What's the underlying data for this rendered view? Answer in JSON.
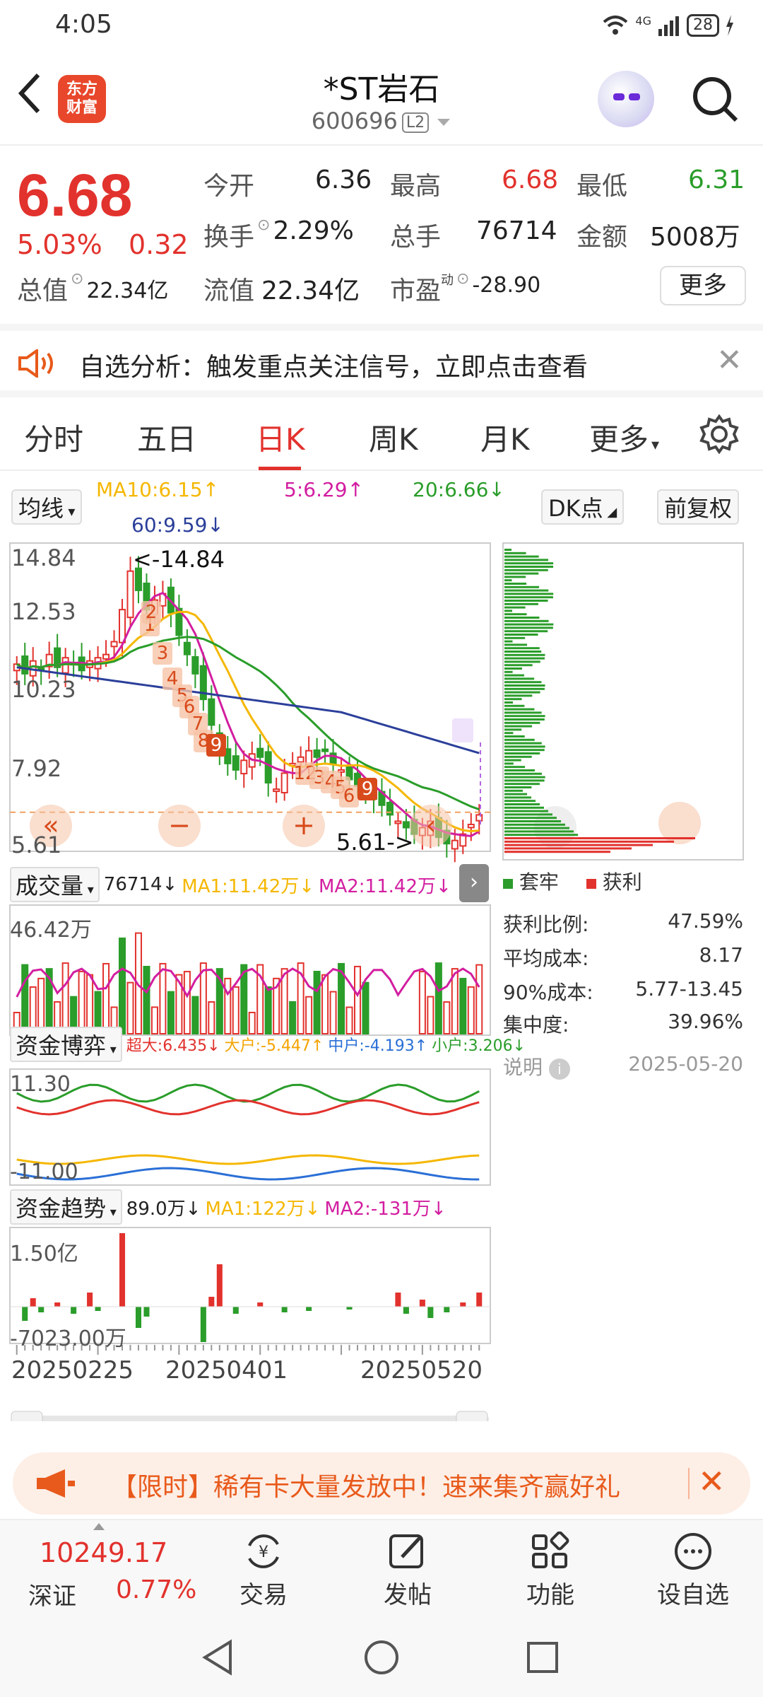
{
  "status": {
    "time": "4:05",
    "network": "4G",
    "battery": "28"
  },
  "header": {
    "name": "*ST岩石",
    "code": "600696",
    "level": "L2",
    "logo_line1": "东方",
    "logo_line2": "财富"
  },
  "quote": {
    "price": "6.68",
    "pct": "5.03%",
    "change": "0.32",
    "open_label": "今开",
    "open": "6.36",
    "high_label": "最高",
    "high": "6.68",
    "low_label": "最低",
    "low": "6.31",
    "turnover_label": "换手",
    "turnover": "2.29%",
    "volume_label": "总手",
    "volume": "76714",
    "amount_label": "金额",
    "amount": "5008万",
    "mktcap_label": "总值",
    "mktcap": "22.34亿",
    "float_label": "流值",
    "float_cap": "22.34亿",
    "pe_label": "市盈",
    "pe_sup": "动",
    "pe": "-28.90",
    "more": "更多"
  },
  "banner": {
    "text": "自选分析：触发重点关注信号，立即点击查看"
  },
  "tabs": [
    "分时",
    "五日",
    "日K",
    "周K",
    "月K",
    "更多"
  ],
  "ma_legend": {
    "select": "均线",
    "ma10": "MA10:6.15↑",
    "ma5": "5:6.29↑",
    "ma20": "20:6.66↓",
    "ma60": "60:9.59↓",
    "dk": "DK点",
    "adjust": "前复权"
  },
  "kline": {
    "y_labels": [
      "14.84",
      "12.53",
      "10.23",
      "7.92",
      "5.61"
    ],
    "high_note": "<-14.84",
    "low_note": "5.61->",
    "td_seq": [
      "1",
      "2",
      "3",
      "4",
      "5",
      "6",
      "7",
      "8",
      "9",
      "12",
      "3",
      "4",
      "5",
      "6",
      "9"
    ]
  },
  "volume": {
    "title": "成交量",
    "vol": "76714↓",
    "ma1": "MA1:11.42万↓",
    "ma2": "MA2:11.42万↓",
    "y_top": "46.42万"
  },
  "capital_game": {
    "title": "资金博弈",
    "super": "超大:6.435↓",
    "big": "大户:-5.447↑",
    "mid": "中户:-4.193↑",
    "small": "小户:3.206↓",
    "y_top": "11.30",
    "y_bottom": "-11.00"
  },
  "capital_trend": {
    "title": "资金趋势",
    "val": "89.0万↓",
    "ma1": "MA1:122万↓",
    "ma2": "MA2:-131万↓",
    "y_top": "1.50亿",
    "y_bottom": "-7023.00万"
  },
  "x_dates": [
    "20250225",
    "20250401",
    "20250520"
  ],
  "chips": {
    "legend_trapped": "套牢",
    "legend_profit": "获利",
    "rows": [
      {
        "label": "获利比例:",
        "value": "47.59%"
      },
      {
        "label": "平均成本:",
        "value": "8.17"
      },
      {
        "label": "90%成本:",
        "value": "5.77-13.45"
      },
      {
        "label": "集中度:",
        "value": "39.96%"
      }
    ],
    "note": "说明",
    "date": "2025-05-20"
  },
  "promo": {
    "text": "【限时】稀有卡大量发放中！速来集齐赢好礼"
  },
  "bottom": {
    "idx_value": "10249.17",
    "idx_name": "深证",
    "idx_pct": "0.77%",
    "trade": "交易",
    "post": "发帖",
    "func": "功能",
    "watch": "设自选"
  },
  "colors": {
    "up": "#e2322d",
    "down": "#2a9d2a",
    "ma5": "#d21ea0",
    "ma10": "#f5b700",
    "ma20": "#2a9d2a",
    "ma60": "#2b3f9a"
  }
}
